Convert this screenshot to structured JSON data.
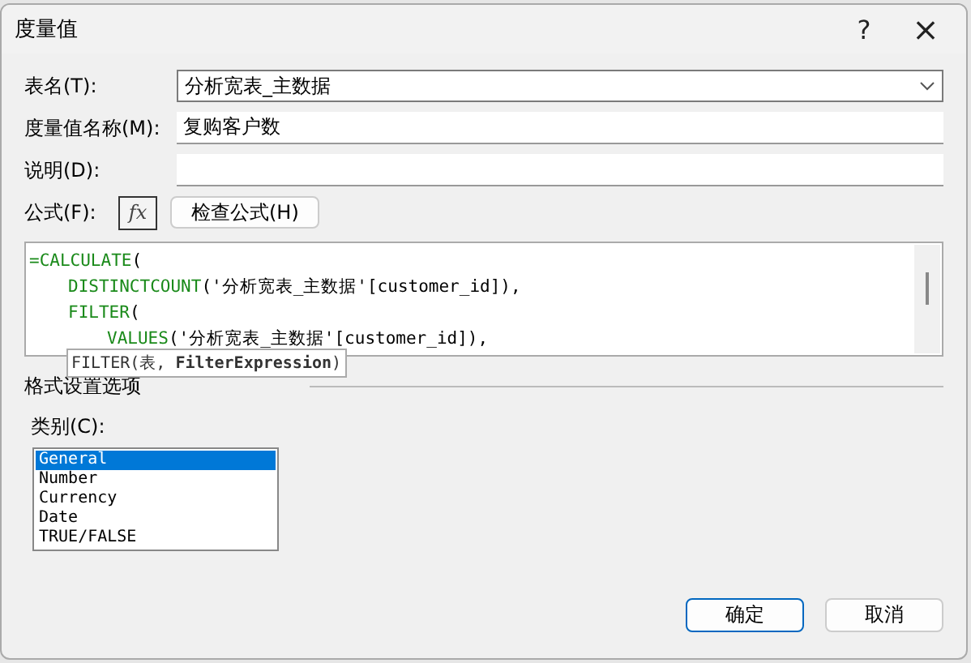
{
  "window": {
    "title": "度量值",
    "help": "?",
    "close": "×"
  },
  "fields": [
    {
      "label": "表名(T):",
      "kind": "dropdown",
      "value": "分析宽表_主数据"
    },
    {
      "label": "度量值名称(M):",
      "kind": "text",
      "value": "复购客户数"
    },
    {
      "label": "说明(D):",
      "kind": "text"
    }
  ],
  "formula": {
    "label": "公式(F):",
    "fx": "fx",
    "check_button": "检查公式(H)",
    "lines": [
      {
        "fn": "=CALCULATE",
        "rest": "(",
        "children": [
          {
            "fn": "DISTINCTCOUNT",
            "rest": "('分析宽表_主数据'[customer_id]),"
          },
          {
            "fn": "FILTER",
            "rest": "(",
            "children": [
              {
                "fn": "VALUES",
                "rest": "('分析宽表_主数据'[customer_id]),"
              }
            ]
          }
        ]
      }
    ],
    "tooltip": "FILTER(表, **FilterExpression**)"
  },
  "format": {
    "title": "格式设置选项",
    "category_label": "类别(C):",
    "categories": [
      {
        "label": "General",
        "selected": true
      },
      {
        "label": "Number",
        "selected": false
      },
      {
        "label": "Currency",
        "selected": false
      },
      {
        "label": "Date",
        "selected": false
      },
      {
        "label": "TRUE/FALSE",
        "selected": false
      }
    ]
  },
  "buttons": [
    {
      "label": "确定",
      "kind": "primary"
    },
    {
      "label": "取消",
      "kind": "secondary"
    }
  ]
}
